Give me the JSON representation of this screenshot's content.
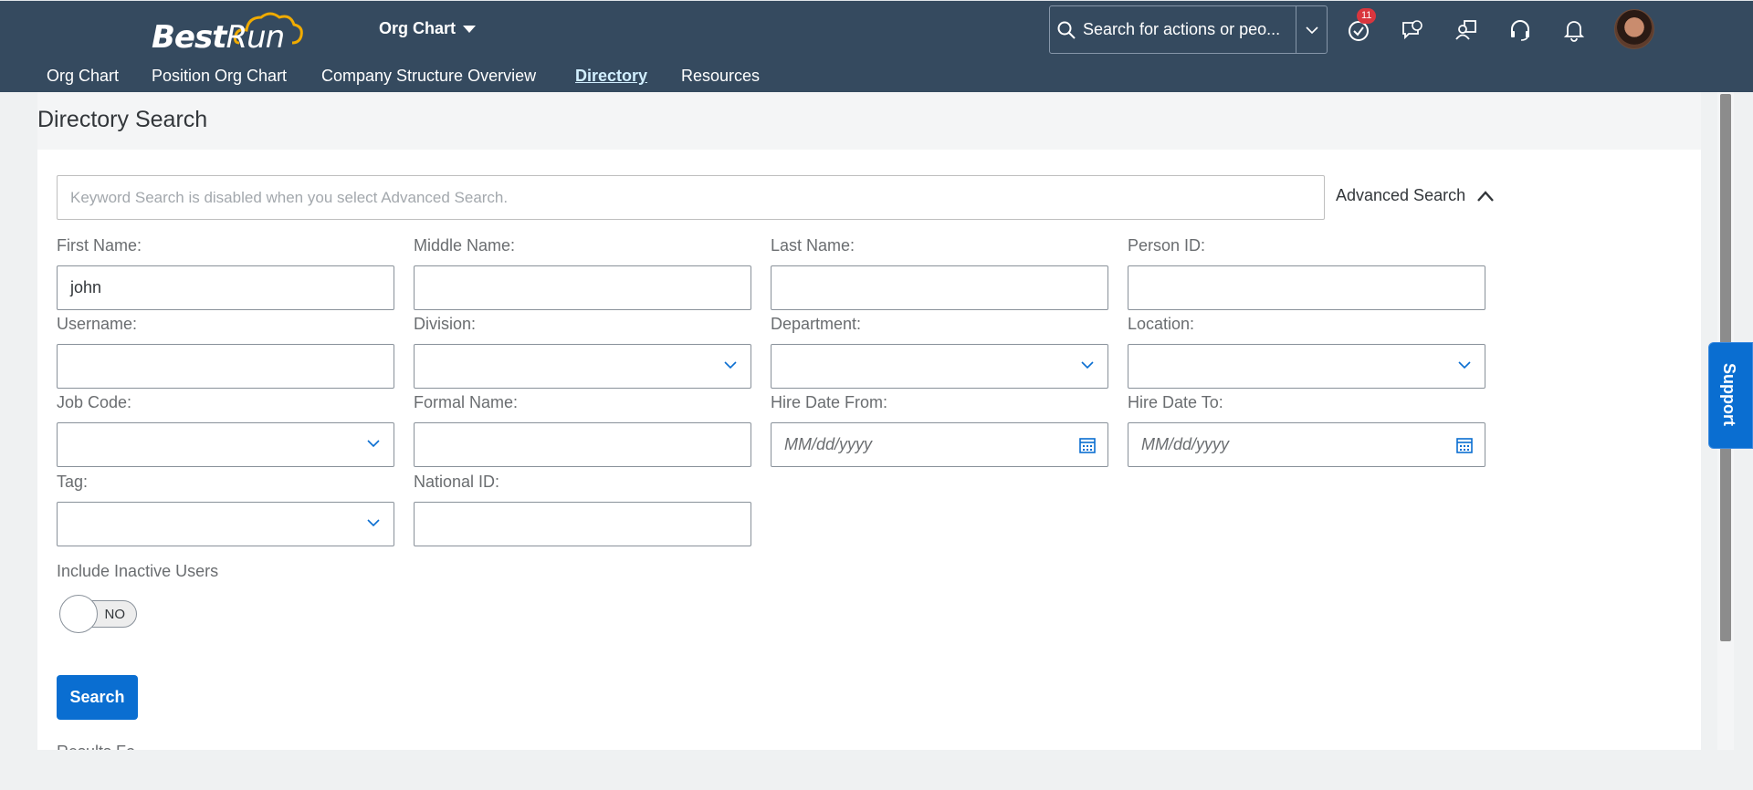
{
  "header": {
    "logo_text_best": "Best",
    "logo_text_run": "Run",
    "module": "Org Chart",
    "search_placeholder": "Search for actions or peo...",
    "notification_badge": "11"
  },
  "nav": {
    "items": [
      {
        "label": "Org Chart"
      },
      {
        "label": "Position Org Chart"
      },
      {
        "label": "Company Structure Overview"
      },
      {
        "label": "Directory"
      },
      {
        "label": "Resources"
      }
    ],
    "active": "Directory"
  },
  "page": {
    "title": "Directory Search",
    "keyword_placeholder": "Keyword Search is disabled when you select Advanced Search.",
    "advanced_search": "Advanced Search"
  },
  "form": {
    "first_name": {
      "label": "First Name:",
      "value": "john"
    },
    "middle_name": {
      "label": "Middle Name:",
      "value": ""
    },
    "last_name": {
      "label": "Last Name:",
      "value": ""
    },
    "person_id": {
      "label": "Person ID:",
      "value": ""
    },
    "username": {
      "label": "Username:",
      "value": ""
    },
    "division": {
      "label": "Division:",
      "value": ""
    },
    "department": {
      "label": "Department:",
      "value": ""
    },
    "location": {
      "label": "Location:",
      "value": ""
    },
    "job_code": {
      "label": "Job Code:",
      "value": ""
    },
    "formal_name": {
      "label": "Formal Name:",
      "value": ""
    },
    "hire_date_from": {
      "label": "Hire Date From:",
      "placeholder": "MM/dd/yyyy"
    },
    "hire_date_to": {
      "label": "Hire Date To:",
      "placeholder": "MM/dd/yyyy"
    },
    "tag": {
      "label": "Tag:",
      "value": ""
    },
    "national_id": {
      "label": "National ID:",
      "value": ""
    },
    "include_inactive": {
      "label": "Include Inactive Users",
      "state": "NO"
    },
    "search_button": "Search",
    "results_partial": "Results Fo..."
  },
  "support": {
    "label": "Support"
  },
  "colors": {
    "header_bg": "#354a5f",
    "accent": "#0a6ed1",
    "badge": "#d9363e"
  },
  "icons": [
    "search-icon",
    "chevron-down-icon",
    "todo-icon",
    "feedback-icon",
    "people-icon",
    "headset-icon",
    "bell-icon",
    "calendar-icon",
    "chevron-up-icon"
  ]
}
